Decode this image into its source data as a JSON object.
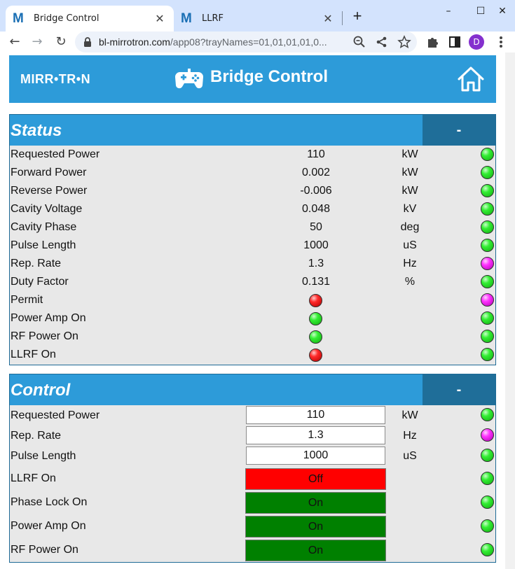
{
  "browser": {
    "tabs": [
      {
        "favicon": "M",
        "title": "Bridge Control",
        "close": "✕"
      },
      {
        "favicon": "M",
        "title": "LLRF",
        "close": "✕"
      }
    ],
    "new_tab": "+",
    "url_host": "bl-mirrotron.com",
    "url_rest": "/app08?trayNames=01,01,01,01,0...",
    "profile_initial": "D",
    "window_controls": {
      "minimize": "–",
      "maximize": "☐",
      "close": "✕"
    },
    "nav": {
      "back": "←",
      "forward": "→",
      "reload": "↻"
    },
    "icons": {
      "zoom": "zoom-out-icon",
      "share": "share-icon",
      "star": "star-icon",
      "extensions": "puzzle-icon",
      "sidepanel": "side-panel-icon",
      "menu": "kebab-menu-icon"
    }
  },
  "app": {
    "logo": "MIRR•TR•N",
    "title": "Bridge Control",
    "colors": {
      "header": "#2d9bd9",
      "panel_bg": "#e8e8e8",
      "collapse_btn": "#1f6e99",
      "off_red": "#ff0000",
      "on_green": "#008000"
    }
  },
  "status": {
    "title": "Status",
    "collapse_label": "-",
    "rows": [
      {
        "label": "Requested Power",
        "value": "110",
        "unit": "kW",
        "led": "green"
      },
      {
        "label": "Forward Power",
        "value": "0.002",
        "unit": "kW",
        "led": "green"
      },
      {
        "label": "Reverse Power",
        "value": "-0.006",
        "unit": "kW",
        "led": "green"
      },
      {
        "label": "Cavity Voltage",
        "value": "0.048",
        "unit": "kV",
        "led": "green"
      },
      {
        "label": "Cavity Phase",
        "value": "50",
        "unit": "deg",
        "led": "green"
      },
      {
        "label": "Pulse Length",
        "value": "1000",
        "unit": "uS",
        "led": "green"
      },
      {
        "label": "Rep. Rate",
        "value": "1.3",
        "unit": "Hz",
        "led": "magenta"
      },
      {
        "label": "Duty Factor",
        "value": "0.131",
        "unit": "%",
        "led": "green"
      },
      {
        "label": "Permit",
        "state_led": "red",
        "led": "magenta"
      },
      {
        "label": "Power Amp On",
        "state_led": "green",
        "led": "green"
      },
      {
        "label": "RF Power On",
        "state_led": "green",
        "led": "green"
      },
      {
        "label": "LLRF On",
        "state_led": "red",
        "led": "green"
      }
    ]
  },
  "control": {
    "title": "Control",
    "collapse_label": "-",
    "inputs": [
      {
        "label": "Requested Power",
        "value": "110",
        "unit": "kW",
        "led": "green"
      },
      {
        "label": "Rep. Rate",
        "value": "1.3",
        "unit": "Hz",
        "led": "magenta"
      },
      {
        "label": "Pulse Length",
        "value": "1000",
        "unit": "uS",
        "led": "green"
      }
    ],
    "toggles": [
      {
        "label": "LLRF On",
        "state": "Off",
        "color": "#ff0000",
        "led": "green"
      },
      {
        "label": "Phase Lock On",
        "state": "On",
        "color": "#008000",
        "led": "green"
      },
      {
        "label": "Power Amp On",
        "state": "On",
        "color": "#008000",
        "led": "green"
      },
      {
        "label": "RF Power On",
        "state": "On",
        "color": "#008000",
        "led": "green"
      }
    ]
  }
}
